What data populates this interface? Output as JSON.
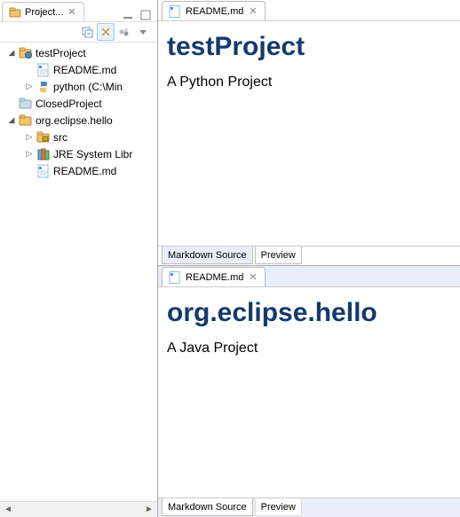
{
  "projectExplorer": {
    "viewTabLabel": "Project...",
    "tree": [
      {
        "label": "testProject",
        "kind": "python-project",
        "expandable": true,
        "open": true,
        "level": 1
      },
      {
        "label": "README.md",
        "kind": "md-file",
        "expandable": false,
        "level": 2
      },
      {
        "label": "python  (C:\\Min",
        "kind": "python-env",
        "expandable": true,
        "open": false,
        "level": 2
      },
      {
        "label": "ClosedProject",
        "kind": "closed-project",
        "expandable": false,
        "level": 1
      },
      {
        "label": "org.eclipse.hello",
        "kind": "java-project",
        "expandable": true,
        "open": true,
        "level": 1
      },
      {
        "label": "src",
        "kind": "package-folder",
        "expandable": true,
        "open": false,
        "level": 2
      },
      {
        "label": "JRE System Libr",
        "kind": "jre-lib",
        "expandable": true,
        "open": false,
        "level": 2
      },
      {
        "label": "README.md",
        "kind": "md-file",
        "expandable": false,
        "level": 2
      }
    ]
  },
  "editors": [
    {
      "tabLabel": "README.md",
      "heading": "testProject",
      "paragraph": "A Python Project",
      "bottomTabs": {
        "source": "Markdown Source",
        "preview": "Preview",
        "active": "preview"
      }
    },
    {
      "tabLabel": "README.md",
      "heading": "org.eclipse.hello",
      "paragraph": "A Java Project",
      "bottomTabs": {
        "source": "Markdown Source",
        "preview": "Preview",
        "active": "source"
      }
    }
  ],
  "colors": {
    "heading": "#143a6b"
  }
}
